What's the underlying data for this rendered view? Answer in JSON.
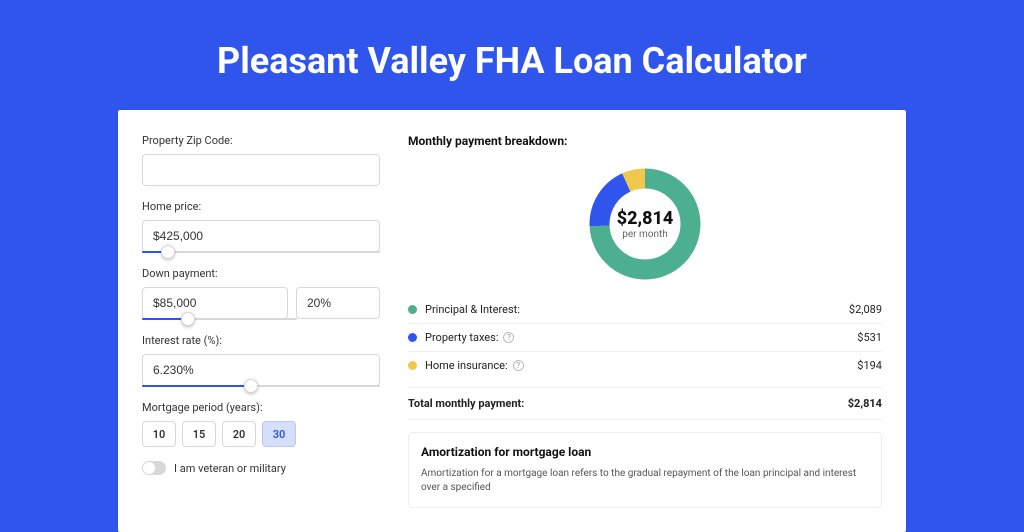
{
  "hero": {
    "title": "Pleasant Valley FHA Loan Calculator"
  },
  "form": {
    "zip": {
      "label": "Property Zip Code:",
      "value": ""
    },
    "price": {
      "label": "Home price:",
      "value": "$425,000",
      "slider_pct": 11
    },
    "down": {
      "label": "Down payment:",
      "amount": "$85,000",
      "pct": "20%",
      "slider_pct": 30
    },
    "rate": {
      "label": "Interest rate (%):",
      "value": "6.230%",
      "slider_pct": 46
    },
    "period": {
      "label": "Mortgage period (years):",
      "options": [
        "10",
        "15",
        "20",
        "30"
      ],
      "active": "30"
    },
    "veteran": {
      "label": "I am veteran or military",
      "on": false
    }
  },
  "breakdown": {
    "heading": "Monthly payment breakdown:",
    "center_amount": "$2,814",
    "center_sub": "per month",
    "items": [
      {
        "color": "#4caf8f",
        "label": "Principal & Interest:",
        "amount": "$2,089",
        "share": 0.742,
        "help": false
      },
      {
        "color": "#2f55ed",
        "label": "Property taxes:",
        "amount": "$531",
        "share": 0.189,
        "help": true
      },
      {
        "color": "#f0c94c",
        "label": "Home insurance:",
        "amount": "$194",
        "share": 0.069,
        "help": true
      }
    ],
    "total_label": "Total monthly payment:",
    "total_amount": "$2,814"
  },
  "amort": {
    "heading": "Amortization for mortgage loan",
    "body": "Amortization for a mortgage loan refers to the gradual repayment of the loan principal and interest over a specified"
  },
  "chart_data": {
    "type": "pie",
    "title": "Monthly payment breakdown",
    "categories": [
      "Principal & Interest",
      "Property taxes",
      "Home insurance"
    ],
    "values": [
      2089,
      531,
      194
    ],
    "total": 2814,
    "unit": "$ per month"
  }
}
